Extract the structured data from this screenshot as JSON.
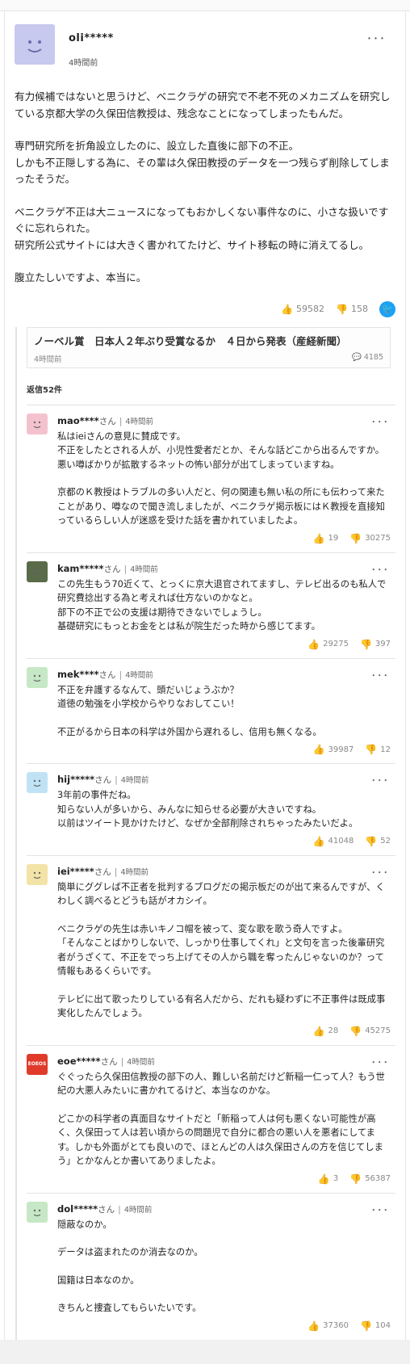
{
  "main_comment": {
    "user": "oli*****",
    "time": "4時間前",
    "avatar_color": "#c8c9ef",
    "paragraphs": [
      "有力候補ではないと思うけど、ベニクラゲの研究で不老不死のメカニズムを研究している京都大学の久保田信教授は、残念なことになってしまったもんだ。",
      "専門研究所を折角設立したのに、設立した直後に部下の不正。\nしかも不正隠しする為に、その輩は久保田教授のデータを一つ残らず削除してしまったそうだ。",
      "ベニクラゲ不正は大ニュースになってもおかしくない事件なのに、小さな扱いですぐに忘れられた。\n研究所公式サイトには大きく書かれてたけど、サイト移転の時に消えてるし。",
      "腹立たしいですよ、本当に。"
    ],
    "likes": "59582",
    "dislikes": "158",
    "more": "･･･",
    "twitter_color": "#1da1f2"
  },
  "article": {
    "title": "ノーベル賞　日本人２年ぶり受賞なるか　４日から発表（産経新聞）",
    "time": "4時間前",
    "comments": "4185"
  },
  "reply_count": "返信52件",
  "replies": [
    {
      "user": "mao****",
      "suffix": "さん",
      "time": "4時間前",
      "avatar_color": "#f4c2cf",
      "paragraphs": [
        "私はieiさんの意見に賛成です。\n不正をしたとされる人が、小児性愛者だとか、そんな話どこから出るんですか。\n悪い噂ばかりが拡散するネットの怖い部分が出てしまっていますね。",
        "京都のＫ教授はトラブルの多い人だと、何の関連も無い私の所にも伝わって来たことがあり、噂なので聞き流しましたが、ベニクラゲ掲示板にはＫ教授を直接知っているらしい人が迷惑を受けた話を書かれていましたよ。"
      ],
      "likes": "19",
      "dislikes": "30275"
    },
    {
      "user": "kam*****",
      "suffix": "さん",
      "time": "4時間前",
      "avatar_color": "#5a6b4a",
      "paragraphs": [
        "この先生もう70近くて、とっくに京大退官されてますし、テレビ出るのも私人で研究費捻出する為と考えれば仕方ないのかなと。\n部下の不正で公の支援は期待できないでしょうし。\n基礎研究にもっとお金をとは私が院生だった時から感じてます。"
      ],
      "likes": "29275",
      "dislikes": "397"
    },
    {
      "user": "mek****",
      "suffix": "さん",
      "time": "4時間前",
      "avatar_color": "#c6e8c6",
      "paragraphs": [
        "不正を弁護するなんて、頭だいじょうぶか？\n道徳の勉強を小学校からやりなおしてこい！",
        "不正がるから日本の科学は外国から遅れるし、信用も無くなる。"
      ],
      "likes": "39987",
      "dislikes": "12"
    },
    {
      "user": "hij*****",
      "suffix": "さん",
      "time": "4時間前",
      "avatar_color": "#bfe3f5",
      "paragraphs": [
        "3年前の事件だね。\n知らない人が多いから、みんなに知らせる必要が大きいですね。\n以前はツイート見かけたけど、なぜか全部削除されちゃったみたいだよ。"
      ],
      "likes": "41048",
      "dislikes": "52"
    },
    {
      "user": "iei*****",
      "suffix": "さん",
      "time": "4時間前",
      "avatar_color": "#f3e3a6",
      "paragraphs": [
        "簡単にググレば不正者を批判するブログだの掲示板だのが出て来るんですが、くわしく調べるとどうも話がオカシイ。",
        "ベニクラゲの先生は赤いキノコ帽を被って、変な歌を歌う奇人ですよ。\n「そんなことばかりしないで、しっかり仕事してくれ」と文句を言った後輩研究者がうざくて、不正をでっち上げてその人から職を奪ったんじゃないのか？って情報もあるくらいです。",
        "テレビに出て歌ったりしている有名人だから、だれも疑わずに不正事件は既成事実化したんでしょう。"
      ],
      "likes": "28",
      "dislikes": "45275"
    },
    {
      "user": "eoe*****",
      "suffix": "さん",
      "time": "4時間前",
      "avatar_color": "#e03a2a",
      "avatar_text": "EOEOS",
      "paragraphs": [
        "ぐぐったら久保田信教授の部下の人、難しい名前だけど新稲一仁って人？もう世紀の大悪人みたいに書かれてるけど、本当なのかな。",
        "どこかの科学者の真面目なサイトだと「新稲って人は何も悪くない可能性が高く、久保田って人は若い頃からの問題児で自分に都合の悪い人を悪者にしてます。しかも外面がとても良いので、ほとんどの人は久保田さんの方を信じてしまう」とかなんとか書いてありましたよ。"
      ],
      "likes": "3",
      "dislikes": "56387"
    },
    {
      "user": "dol*****",
      "suffix": "さん",
      "time": "4時間前",
      "avatar_color": "#c6e8c6",
      "paragraphs": [
        "隠蔽なのか。",
        "データは盗まれたのか消去なのか。",
        "国籍は日本なのか。",
        "きちんと捜査してもらいたいです。"
      ],
      "likes": "37360",
      "dislikes": "104"
    }
  ]
}
